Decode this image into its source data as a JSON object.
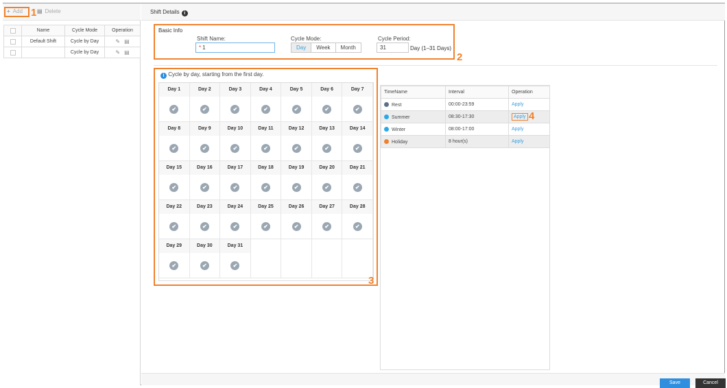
{
  "toolbar": {
    "add_label": "Add",
    "delete_label": "Delete"
  },
  "shift_table": {
    "headers": [
      "",
      "Name",
      "Cycle Mode",
      "Operation"
    ],
    "rows": [
      {
        "name": "Default Shift",
        "cycle_mode": "Cycle by Day"
      },
      {
        "name": "",
        "cycle_mode": "Cycle by Day"
      }
    ]
  },
  "details": {
    "title": "Shift Details",
    "basic_info": "Basic Info",
    "shift_name_label": "Shift Name:",
    "shift_name_value": "1",
    "required_mark": "*",
    "cycle_mode_label": "Cycle Mode:",
    "cycle_modes": [
      "Day",
      "Week",
      "Month"
    ],
    "cycle_mode_selected": "Day",
    "cycle_period_label": "Cycle Period:",
    "cycle_period_value": "31",
    "cycle_period_hint": "Day (1–31 Days)"
  },
  "calendar": {
    "hint": "Cycle by day, starting from the first day.",
    "days": [
      "Day 1",
      "Day 2",
      "Day 3",
      "Day 4",
      "Day 5",
      "Day 6",
      "Day 7",
      "Day 8",
      "Day 9",
      "Day 10",
      "Day 11",
      "Day 12",
      "Day 13",
      "Day 14",
      "Day 15",
      "Day 16",
      "Day 17",
      "Day 18",
      "Day 19",
      "Day 20",
      "Day 21",
      "Day 22",
      "Day 23",
      "Day 24",
      "Day 25",
      "Day 26",
      "Day 27",
      "Day 28",
      "Day 29",
      "Day 30",
      "Day 31"
    ]
  },
  "time_table": {
    "headers": [
      "TimeName",
      "Interval",
      "Operation"
    ],
    "rows": [
      {
        "name": "Rest",
        "interval": "00:00-23:59",
        "op": "Apply",
        "color": "#5b7089"
      },
      {
        "name": "Summer",
        "interval": "08:30-17:30",
        "op": "Apply",
        "color": "#2aa8e8"
      },
      {
        "name": "Winter",
        "interval": "08:00-17:00",
        "op": "Apply",
        "color": "#2aa8e8"
      },
      {
        "name": "Holiday",
        "interval": "8  hour(s)",
        "op": "Apply",
        "color": "#f0812b"
      }
    ]
  },
  "callouts": {
    "c1": "1",
    "c2": "2",
    "c3": "3",
    "c4": "4"
  },
  "footer": {
    "save_label": "Save",
    "cancel_label": "Cancel"
  },
  "colors": {
    "callout": "#f0812b",
    "primary": "#2f8fde",
    "link": "#3aa0e0"
  },
  "icons": {
    "add": "plus-icon",
    "delete": "trash-icon",
    "edit": "pencil-icon",
    "check": "check-icon",
    "info": "info-icon"
  }
}
